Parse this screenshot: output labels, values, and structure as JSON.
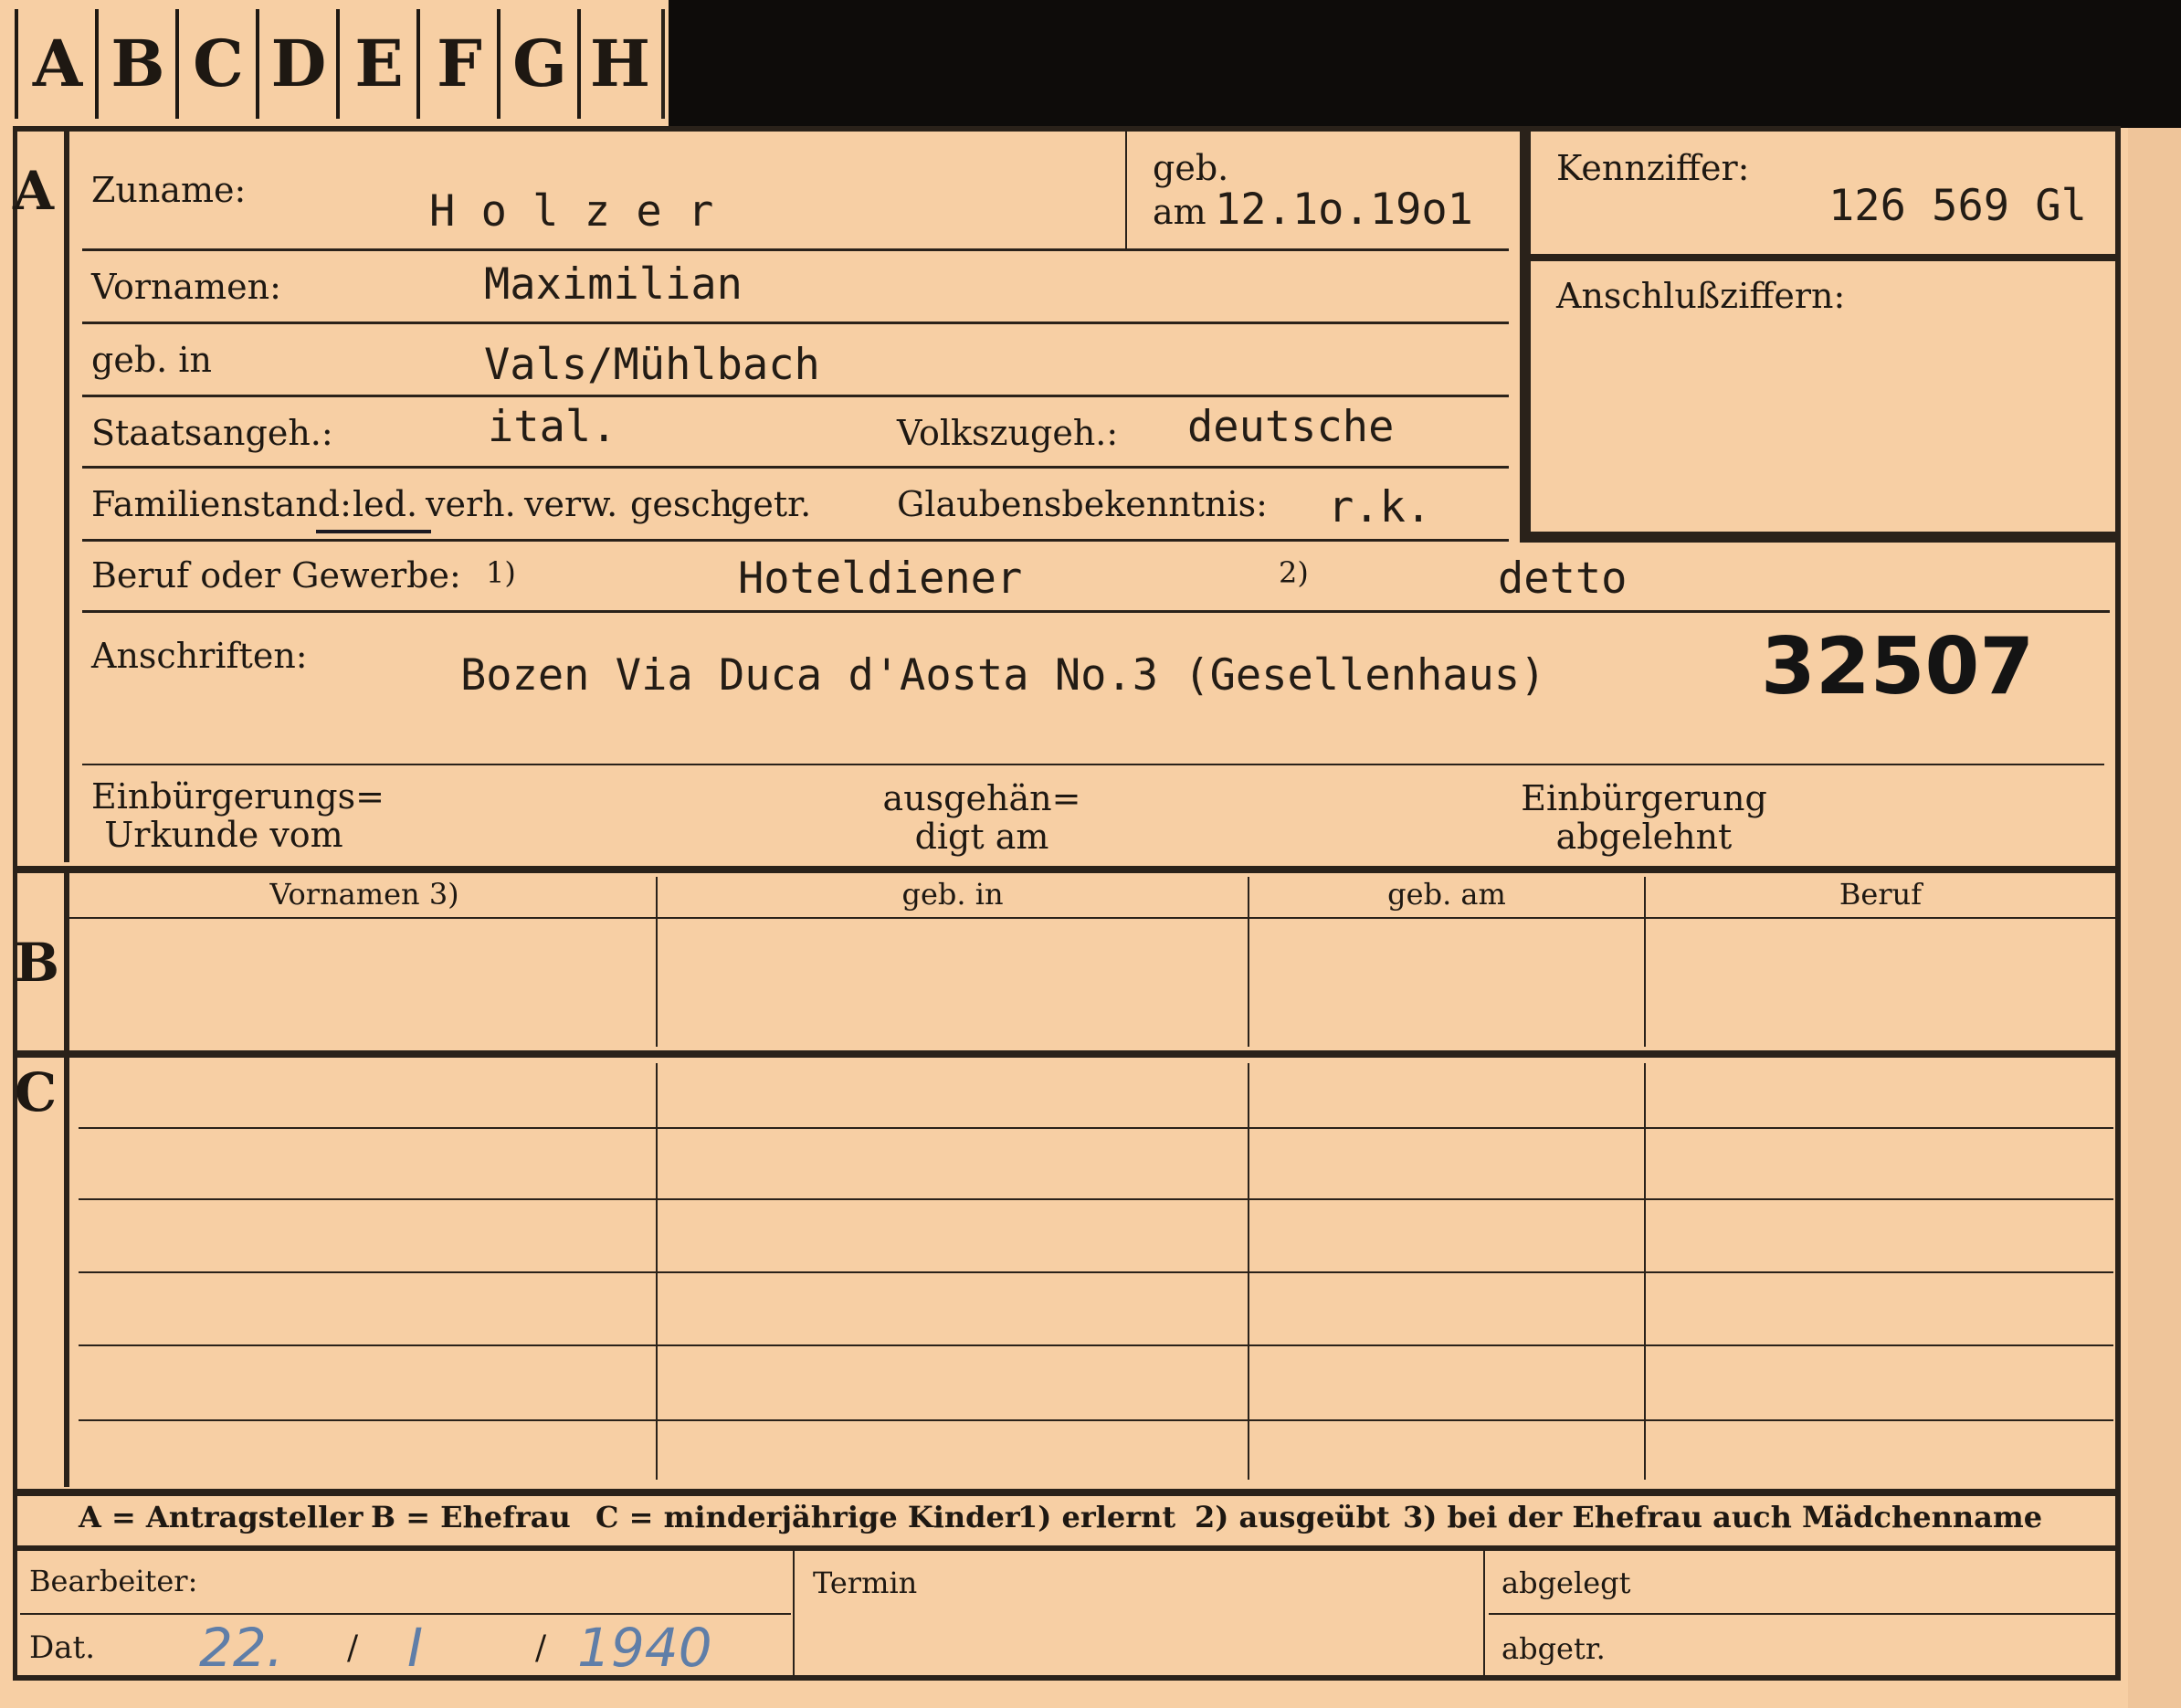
{
  "tabs": [
    "A",
    "B",
    "C",
    "D",
    "E",
    "F",
    "G",
    "H"
  ],
  "section_a": {
    "marker": "A",
    "zuname_label": "Zuname:",
    "zuname_value": "H o l z e r",
    "geb_label": "geb.",
    "geb_am_label": "am",
    "geb_am_value": "12.1o.19o1",
    "vornamen_label": "Vornamen:",
    "vornamen_value": "Maximilian",
    "geb_in_label": "geb. in",
    "geb_in_value": "Vals/Mühlbach",
    "staatsangeh_label": "Staatsangeh.:",
    "staatsangeh_value": "ital.",
    "volkszugeh_label": "Volkszugeh.:",
    "volkszugeh_value": "deutsche",
    "familienstand_label": "Familienstand:",
    "familienstand_options": [
      "led.",
      "verh.",
      "verw.",
      "gesch.",
      "getr."
    ],
    "familienstand_selected": "led.",
    "glaubens_label": "Glaubensbekenntnis:",
    "glaubens_value": "r.k.",
    "beruf_label": "Beruf oder Gewerbe:",
    "beruf_mark1": "1)",
    "beruf_value1": "Hoteldiener",
    "beruf_mark2": "2)",
    "beruf_value2": "detto",
    "anschriften_label": "Anschriften:",
    "anschriften_value": "Bozen Via Duca d'Aosta No.3 (Gesellenhaus)",
    "stamp_number": "32507",
    "einb_urkunde_l1": "Einbürgerungs=",
    "einb_urkunde_l2": "Urkunde vom",
    "ausgeh_l1": "ausgehän=",
    "ausgeh_l2": "digt am",
    "einb_abg_l1": "Einbürgerung",
    "einb_abg_l2": "abgelehnt"
  },
  "kennziffer": {
    "label": "Kennziffer:",
    "value": "126 569 Gl",
    "anschluss_label": "Anschlußziffern:"
  },
  "section_b": {
    "marker": "B",
    "columns": [
      "Vornamen 3)",
      "geb. in",
      "geb. am",
      "Beruf"
    ]
  },
  "section_c": {
    "marker": "C"
  },
  "legend": {
    "a": "A = Antragsteller",
    "b": "B = Ehefrau",
    "c": "C = minderjährige Kinder",
    "n1": "1) erlernt",
    "n2": "2) ausgeübt",
    "n3": "3) bei der Ehefrau auch Mädchenname"
  },
  "footer": {
    "bearbeiter_label": "Bearbeiter:",
    "dat_label": "Dat.",
    "dat_day": "22.",
    "dat_sep1": "/",
    "dat_month": "I",
    "dat_sep2": "/",
    "dat_year": "1940",
    "termin_label": "Termin",
    "abgelegt_label": "abgelegt",
    "abgetr_label": "abgetr."
  }
}
